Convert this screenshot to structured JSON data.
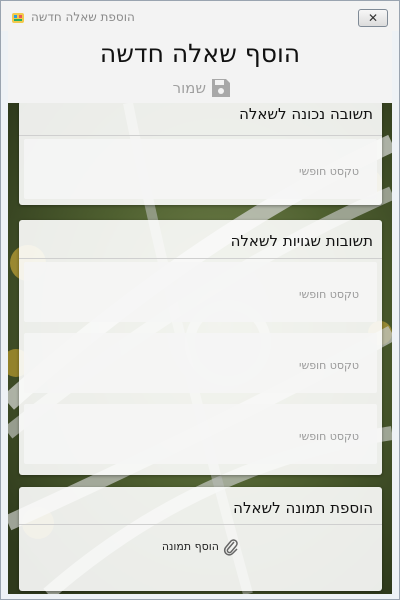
{
  "window": {
    "title": "הוספת שאלה חדשה",
    "close_glyph": "✕"
  },
  "header": {
    "title": "הוסף שאלה חדשה",
    "save_label": "שמור",
    "save_icon": "floppy-disk-icon"
  },
  "sections": {
    "correct": {
      "title": "תשובה נכונה לשאלה",
      "placeholder": "טקסט חופשי"
    },
    "wrong": {
      "title": "תשובות שגויות לשאלה",
      "placeholders": [
        "טקסט חופשי",
        "טקסט חופשי",
        "טקסט חופשי"
      ]
    },
    "image": {
      "title": "הוספת תמונה לשאלה",
      "add_label": "הוסף תמונה",
      "add_icon": "paperclip-icon"
    }
  },
  "colors": {
    "card_bg": "#ffffff",
    "muted_text": "#9a9a9a",
    "titlebar": "#f3f3f3",
    "accent_icon": "#9a9a9a"
  }
}
